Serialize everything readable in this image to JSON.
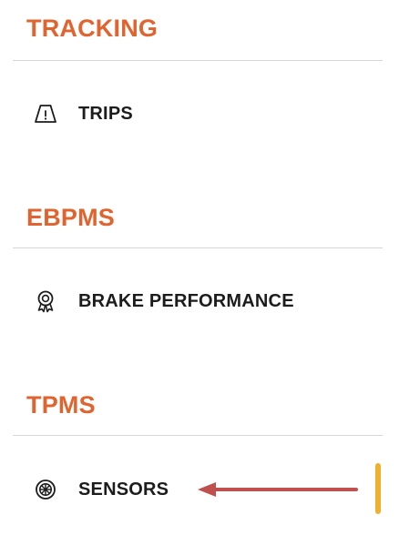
{
  "colors": {
    "section_title": "#e0642f",
    "label": "#1c1c1c",
    "icon": "#1c1c1c",
    "annotation_arrow": "#c0504d",
    "scroll_indicator": "#f0b030"
  },
  "sections": [
    {
      "title": "TRACKING",
      "items": [
        {
          "label": "TRIPS",
          "icon": "warning-triangle-icon"
        }
      ]
    },
    {
      "title": "EBPMS",
      "items": [
        {
          "label": "BRAKE PERFORMANCE",
          "icon": "award-badge-icon"
        }
      ]
    },
    {
      "title": "TPMS",
      "items": [
        {
          "label": "SENSORS",
          "icon": "tire-icon"
        }
      ]
    }
  ]
}
